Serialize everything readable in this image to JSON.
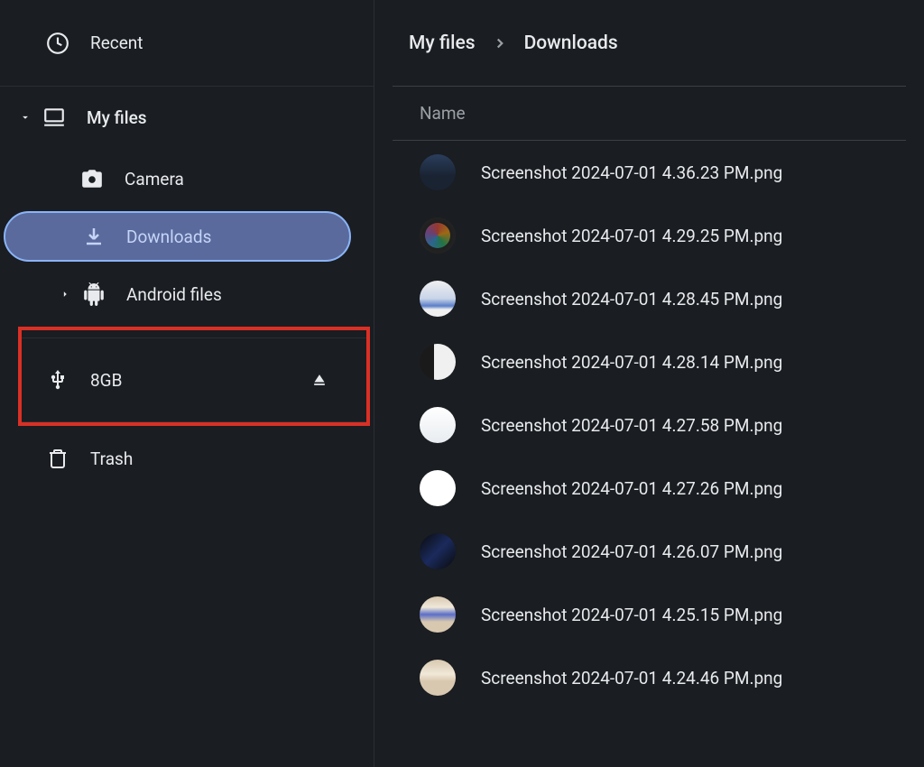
{
  "sidebar": {
    "recent": "Recent",
    "my_files": "My files",
    "camera": "Camera",
    "downloads": "Downloads",
    "android_files": "Android files",
    "usb_drive": "8GB",
    "trash": "Trash"
  },
  "breadcrumb": {
    "root": "My files",
    "current": "Downloads"
  },
  "columns": {
    "name": "Name"
  },
  "files": [
    {
      "name": "Screenshot 2024-07-01 4.36.23 PM.png"
    },
    {
      "name": "Screenshot 2024-07-01 4.29.25 PM.png"
    },
    {
      "name": "Screenshot 2024-07-01 4.28.45 PM.png"
    },
    {
      "name": "Screenshot 2024-07-01 4.28.14 PM.png"
    },
    {
      "name": "Screenshot 2024-07-01 4.27.58 PM.png"
    },
    {
      "name": "Screenshot 2024-07-01 4.27.26 PM.png"
    },
    {
      "name": "Screenshot 2024-07-01 4.26.07 PM.png"
    },
    {
      "name": "Screenshot 2024-07-01 4.25.15 PM.png"
    },
    {
      "name": "Screenshot 2024-07-01 4.24.46 PM.png"
    }
  ],
  "colors": {
    "highlight_border": "#d93025",
    "selection_bg": "#5a6a9c",
    "selection_border": "#8ab4f8"
  }
}
